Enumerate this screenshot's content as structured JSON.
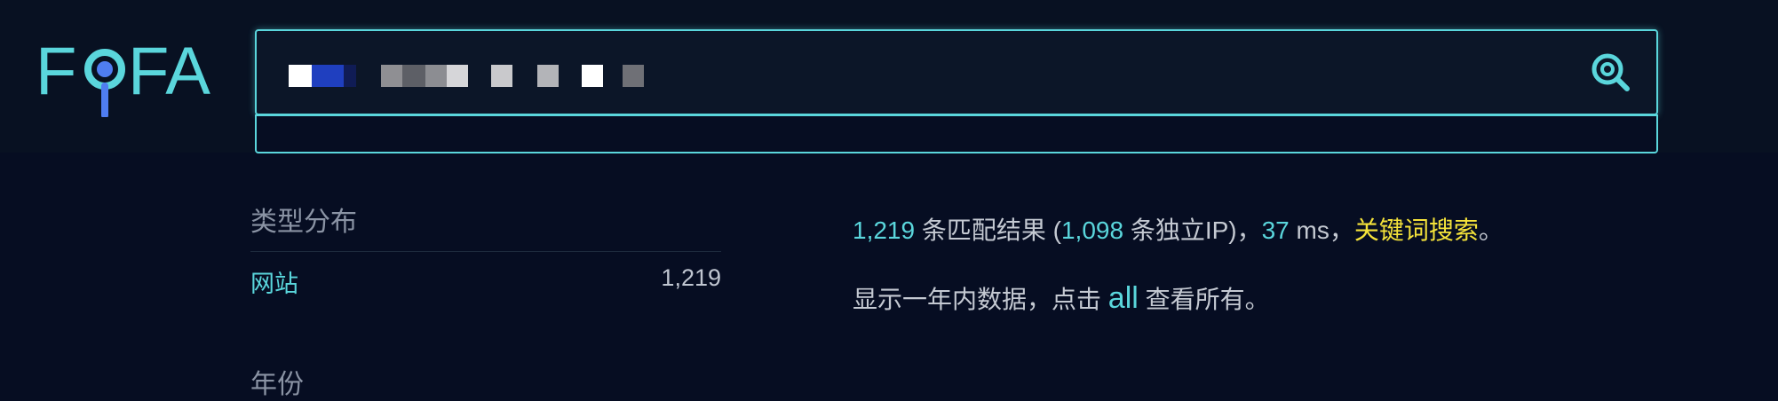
{
  "brand": {
    "name": "FOFA",
    "color": "#5ad6dc",
    "pin_color": "#4f7df1"
  },
  "search": {
    "value": "",
    "button_icon": "search-icon",
    "border_color": "#5ad6dc"
  },
  "sidebar": {
    "type_heading": "类型分布",
    "rows": [
      {
        "label": "网站",
        "count": "1,219"
      }
    ],
    "year_heading": "年份"
  },
  "summary": {
    "total": "1,219",
    "total_text": " 条匹配结果 (",
    "unique_ip": "1,098",
    "unique_ip_text": " 条独立IP)，",
    "time": "37",
    "time_text": " ms，",
    "mode": "关键词搜索",
    "end": "。"
  },
  "notice": {
    "prefix": "显示一年内数据，点击 ",
    "all_link": "all",
    "suffix": " 查看所有。"
  },
  "colors": {
    "accent": "#5ad6dc",
    "highlight": "#f5e33a",
    "background": "#060d22"
  }
}
